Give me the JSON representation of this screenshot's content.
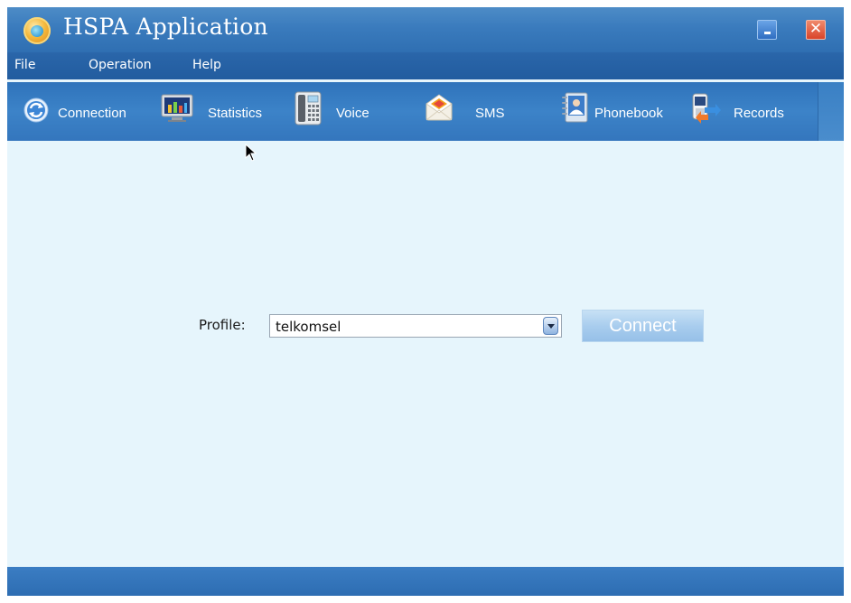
{
  "window": {
    "title": "HSPA Application",
    "minimize_icon": "minimize-icon",
    "close_symbol": "✕"
  },
  "menu": {
    "items": [
      {
        "label": "File"
      },
      {
        "label": "Operation"
      },
      {
        "label": "Help"
      }
    ]
  },
  "toolbar": {
    "items": [
      {
        "label": "Connection",
        "icon": "connection-icon"
      },
      {
        "label": "Statistics",
        "icon": "statistics-icon"
      },
      {
        "label": "Voice",
        "icon": "voice-icon"
      },
      {
        "label": "SMS",
        "icon": "sms-icon"
      },
      {
        "label": "Phonebook",
        "icon": "phonebook-icon"
      },
      {
        "label": "Records",
        "icon": "records-icon"
      }
    ]
  },
  "connection_panel": {
    "profile_label": "Profile:",
    "profile_value": "telkomsel",
    "connect_label": "Connect"
  },
  "colors": {
    "titlebar": "#3a7bbd",
    "menubar": "#225c9f",
    "toolbar": "#3c83c8",
    "content_bg": "#e6f5fc",
    "close_button": "#d9442a",
    "connect_button": "#a9cdee"
  }
}
